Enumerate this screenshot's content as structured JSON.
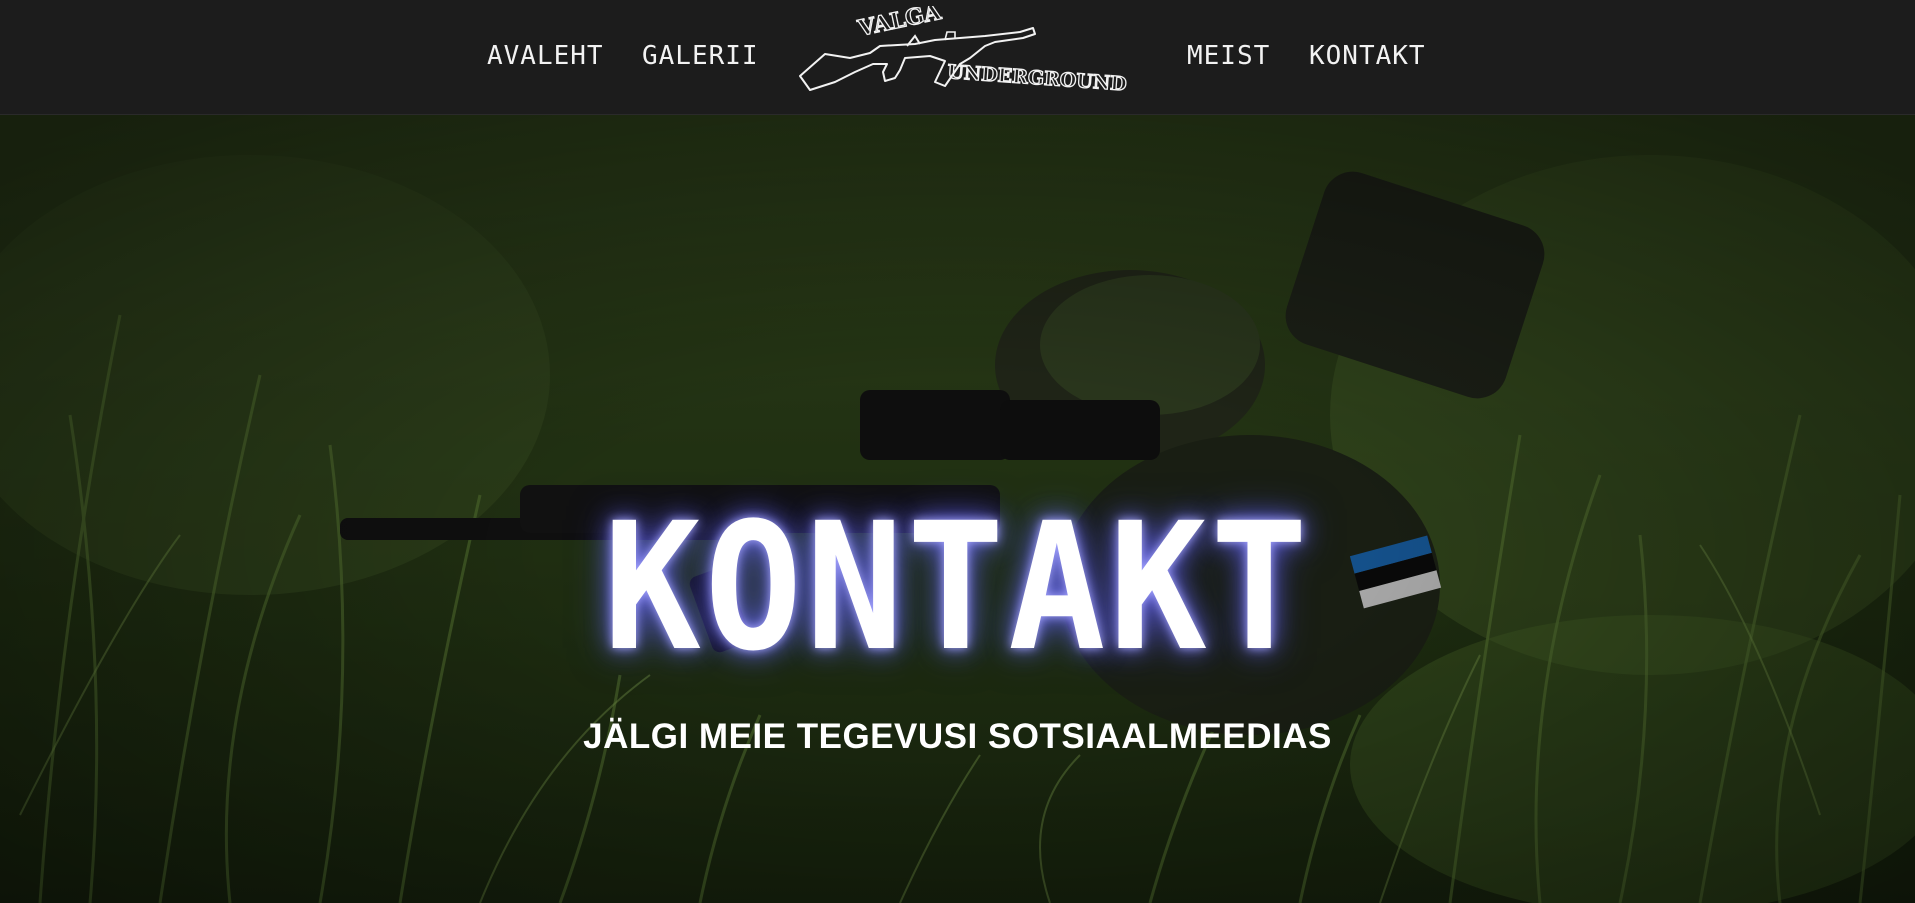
{
  "nav": {
    "links": [
      {
        "label": "AVALEHT"
      },
      {
        "label": "GALERII"
      },
      {
        "label": "MEIST"
      },
      {
        "label": "KONTAKT"
      }
    ],
    "logo": {
      "line1": "VALGA",
      "line2": "UNDERGROUND"
    }
  },
  "hero": {
    "title": "KONTAKT",
    "subtitle": "JÄLGI MEIE TEGEVUSI SOTSIAALMEEDIAS"
  },
  "colors": {
    "navbar_bg": "#1c1c1c",
    "nav_text": "#f2f2f2",
    "title_glow": "#7a7aff",
    "grass_dark": "#1e2c14",
    "grass_mid": "#3d5a22"
  }
}
